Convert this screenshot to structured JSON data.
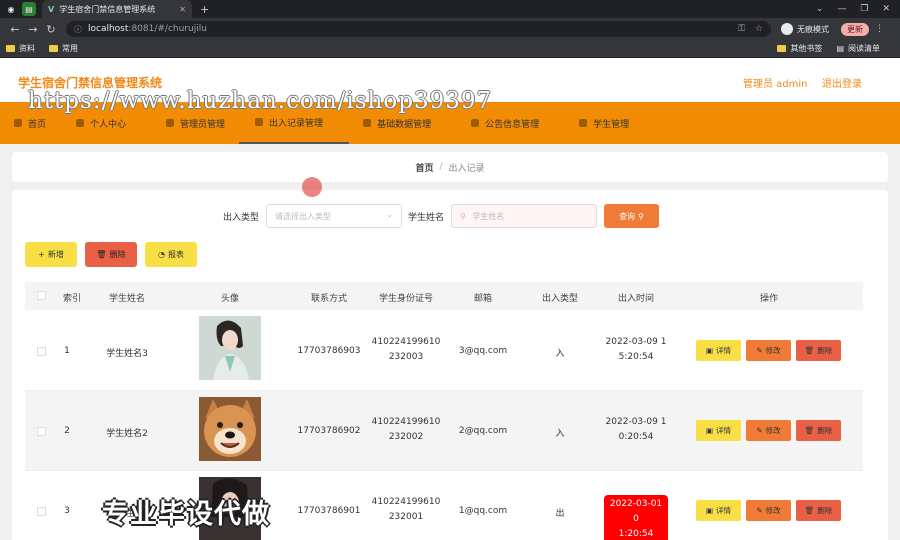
{
  "browser": {
    "tab_title": "学生宿舍门禁信息管理系统",
    "new_tab": "+",
    "url_host": "localhost",
    "url_path": ":8081/#/churujilu",
    "incognito": "无痕模式",
    "update": "更新",
    "bookmarks": [
      "资料",
      "常用"
    ],
    "bookmarks_right": [
      "其他书签",
      "阅读清单"
    ]
  },
  "header": {
    "title": "学生宿舍门禁信息管理系统",
    "admin": "管理员 admin",
    "logout": "退出登录",
    "watermark": "https://www.huzhan.com/ishop39397"
  },
  "nav": [
    "首页",
    "个人中心",
    "管理员管理",
    "出入记录管理",
    "基础数据管理",
    "公告信息管理",
    "学生管理"
  ],
  "breadcrumb": {
    "home": "首页",
    "sep": "/",
    "current": "出入记录"
  },
  "search": {
    "type_label": "出入类型",
    "type_placeholder": "请选择出入类型",
    "name_label": "学生姓名",
    "name_placeholder": "学生姓名",
    "query": "查询"
  },
  "actions": {
    "add": "新增",
    "delete": "删除",
    "report": "报表"
  },
  "table": {
    "headers": [
      "索引",
      "学生姓名",
      "头像",
      "联系方式",
      "学生身份证号",
      "邮箱",
      "出入类型",
      "出入时间",
      "操作"
    ],
    "ops": {
      "detail": "详情",
      "edit": "修改",
      "delete": "删除"
    },
    "rows": [
      {
        "idx": "1",
        "name": "学生姓名3",
        "phone": "17703786903",
        "id1": "410224199610",
        "id2": "232003",
        "email": "3@qq.com",
        "type": "入",
        "t1": "2022-03-09 1",
        "t2": "5:20:54"
      },
      {
        "idx": "2",
        "name": "学生姓名2",
        "phone": "17703786902",
        "id1": "410224199610",
        "id2": "232002",
        "email": "2@qq.com",
        "type": "入",
        "t1": "2022-03-09 1",
        "t2": "0:20:54"
      },
      {
        "idx": "3",
        "name": "学生姓名1",
        "phone": "17703786901",
        "id1": "410224199610",
        "id2": "232001",
        "email": "1@qq.com",
        "type": "出",
        "t1": "2022-03-01 0",
        "t2": "1:20:54"
      }
    ]
  },
  "caption": "专业毕设代做"
}
